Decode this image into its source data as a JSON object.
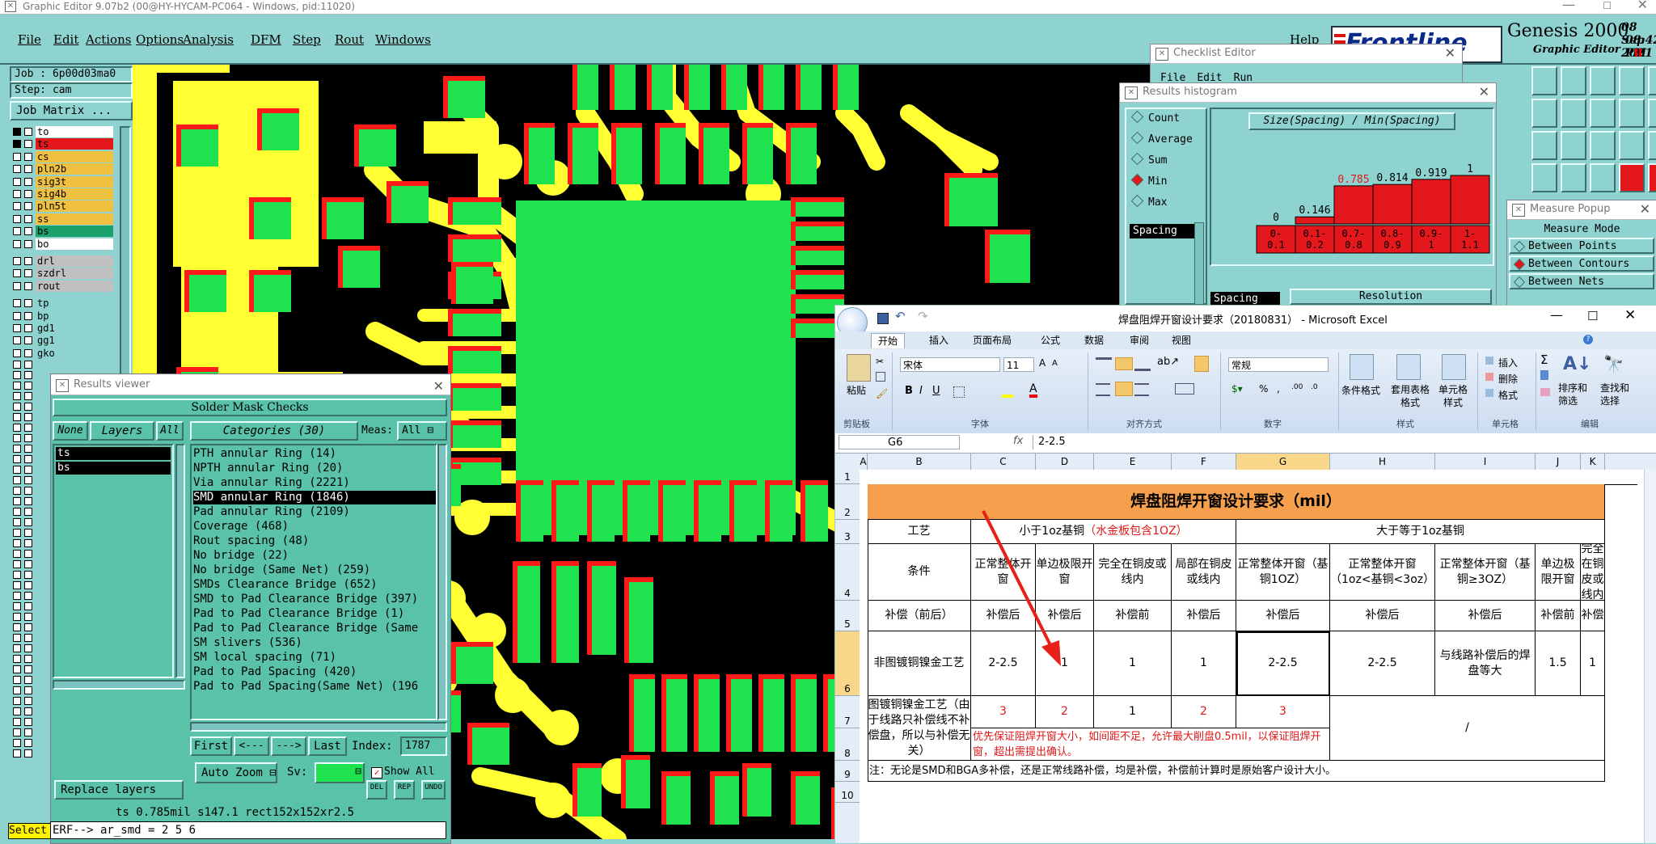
{
  "app": {
    "title": "Graphic Editor 9.07b2 (00@HY-HYCAM-PC064 - Windows, pid:11020)",
    "menu": [
      "File",
      "Edit",
      "Actions",
      "Options",
      "Analysis",
      "DFM",
      "Step",
      "Rout",
      "Windows"
    ],
    "help": "Help",
    "brand": "Frontline",
    "product": "Genesis 2000",
    "product_sub": "Graphic Editor",
    "date": "08 Sep 2021",
    "time": "08:42 PM"
  },
  "job": {
    "job_label": "Job : 6p00d03ma0",
    "step_label": "Step: cam",
    "matrix_button": "Job Matrix ..."
  },
  "layers": {
    "group1": [
      {
        "name": "to",
        "color": "#ffffff",
        "sel": true,
        "flag": true
      },
      {
        "name": "ts",
        "color": "#e4181c",
        "sel": true,
        "flag": true
      },
      {
        "name": "cs",
        "color": "#f0c040",
        "sel": false,
        "flag": true
      },
      {
        "name": "pln2b",
        "color": "#f0c040",
        "sel": false,
        "flag": false
      },
      {
        "name": "sig3t",
        "color": "#f0c040",
        "sel": false,
        "flag": false
      },
      {
        "name": "sig4b",
        "color": "#f0c040",
        "sel": false,
        "flag": false
      },
      {
        "name": "pln5t",
        "color": "#f0c040",
        "sel": false,
        "flag": true
      },
      {
        "name": "ss",
        "color": "#f0c040",
        "sel": false,
        "flag": true
      },
      {
        "name": "bs",
        "color": "#1aa06a",
        "sel": false,
        "flag": true
      },
      {
        "name": "bo",
        "color": "#ffffff",
        "sel": false,
        "flag": true
      }
    ],
    "group2": [
      {
        "name": "drl",
        "color": "#c0c0c0",
        "flag": false
      },
      {
        "name": "szdrl",
        "color": "#c0c0c0",
        "flag": false
      },
      {
        "name": "rout",
        "color": "#c0c0c0",
        "flag": false
      }
    ],
    "group3": [
      {
        "name": "tp",
        "flag": false
      },
      {
        "name": "bp",
        "flag": false
      },
      {
        "name": "gd1",
        "flag": true
      },
      {
        "name": "gg1",
        "flag": false
      },
      {
        "name": "gko",
        "flag": true
      }
    ]
  },
  "results_viewer": {
    "title": "Results viewer",
    "heading": "Solder Mask Checks",
    "none": "None",
    "layers": "Layers",
    "all": "All",
    "categories_label": "Categories (30)",
    "meas_label": "Meas:",
    "meas_value": "All",
    "layer_list": [
      "ts",
      "bs"
    ],
    "categories": [
      "PTH annular Ring (14)",
      "NPTH annular Ring (20)",
      "Via annular Ring (2221)",
      "SMD annular Ring (1846)",
      "Pad annular Ring (2109)",
      "Coverage (468)",
      "Rout spacing (48)",
      "No bridge (22)",
      "No bridge (Same Net) (259)",
      "SMDs Clearance Bridge (652)",
      "SMD to Pad Clearance Bridge (397)",
      "Pad to Pad Clearance Bridge (1)",
      "Pad to Pad Clearance Bridge (Same",
      "SM slivers (536)",
      "SM local spacing (71)",
      "Pad to Pad Spacing (420)",
      "Pad to Pad Spacing(Same Net) (196"
    ],
    "selected_index": 3,
    "nav": {
      "first": "First",
      "prev": "<---",
      "next": "--->",
      "last": "Last",
      "index_label": "Index:",
      "index_value": "1787"
    },
    "auto_zoom": "Auto Zoom",
    "sv_label": "Sv:",
    "show_all": "Show All",
    "replace_layers": "Replace layers",
    "icons": [
      "DEL",
      "REP",
      "UNDO"
    ],
    "status": "ts  0.785mil  s147.1  rect152x152xr2.5",
    "command": "ERF--> ar_smd = 2 5 6",
    "select_label": "Select"
  },
  "checklist": {
    "title": "Checklist Editor",
    "menu": [
      "File",
      "Edit",
      "Run"
    ]
  },
  "histogram": {
    "title": "Results histogram",
    "modes": [
      "Count",
      "Average",
      "Sum",
      "Min",
      "Max"
    ],
    "selected_mode": "Min",
    "spacing_label": "Spacing",
    "chart_title": "Size(Spacing) / Min(Spacing)",
    "resolution_label": "Resolution",
    "spacing_label2": "Spacing"
  },
  "chart_data": {
    "type": "bar",
    "title": "Size(Spacing) / Min(Spacing)",
    "categories": [
      "0-0.1",
      "0.1-0.2",
      "0.7-0.8",
      "0.8-0.9",
      "0.9-1",
      "1-1.1"
    ],
    "values": [
      0,
      0.146,
      0.785,
      0.814,
      0.919,
      1
    ],
    "labels": [
      "0",
      "0.146",
      "0.785",
      "0.814",
      "0.919",
      "1"
    ],
    "highlight_index": 2,
    "ylim": [
      0,
      1
    ]
  },
  "measure": {
    "title": "Measure Popup",
    "mode_label": "Measure Mode",
    "options": [
      "Between Points",
      "Between Contours",
      "Between Nets"
    ]
  },
  "excel": {
    "title": "焊盘阻焊开窗设计要求（20180831） - Microsoft Excel",
    "tabs": [
      "开始",
      "插入",
      "页面布局",
      "公式",
      "数据",
      "审阅",
      "视图"
    ],
    "clipboard": {
      "paste": "粘贴",
      "group": "剪贴板"
    },
    "font": {
      "name": "宋体",
      "size": "11",
      "group": "字体"
    },
    "align_group": "对齐方式",
    "number": {
      "format": "常规",
      "group": "数字"
    },
    "styles": {
      "conditional": "条件格式",
      "table": "套用表格格式",
      "cell": "单元格样式",
      "group": "样式"
    },
    "cells": {
      "insert": "插入",
      "delete": "删除",
      "format": "格式",
      "group": "单元格"
    },
    "editing": {
      "sum": "Σ",
      "sort": "排序和筛选",
      "find": "查找和选择",
      "group": "编辑"
    },
    "name_box": "G6",
    "fx": "fx",
    "formula": "2-2.5",
    "columns": [
      "A",
      "B",
      "C",
      "D",
      "E",
      "F",
      "G",
      "H",
      "I",
      "J",
      "K"
    ],
    "rows": [
      "1",
      "2",
      "3",
      "4",
      "5",
      "6",
      "7",
      "8",
      "9",
      "10"
    ],
    "sheet": {
      "main_title": "焊盘阻焊开窗设计要求（mil）",
      "process": "工艺",
      "lt1oz": "小于1oz基铜",
      "lt1oz_note": "（水金板包含1OZ）",
      "ge1oz": "大于等于1oz基铜",
      "condition": "条件",
      "headers": [
        "正常整体开窗",
        "单边极限开窗",
        "完全在铜皮或线内",
        "局部在铜皮或线内",
        "正常整体开窗（基铜1OZ）",
        "正常整体开窗（1oz<基铜<3oz）",
        "正常整体开窗（基铜≥3OZ）",
        "单边极限开窗",
        "完全在铜皮或线内"
      ],
      "comp_label": "补偿（前后）",
      "comp": [
        "补偿后",
        "补偿后",
        "补偿前",
        "补偿后",
        "补偿后",
        "补偿后",
        "补偿后",
        "补偿前",
        "补偿"
      ],
      "row6_label": "非图镀铜镍金工艺",
      "row6": [
        "2-2.5",
        "1",
        "1",
        "1",
        "2-2.5",
        "2-2.5",
        "与线路补偿后的焊盘等大",
        "1.5",
        "1"
      ],
      "row7_label": "图镀铜镍金工艺（由于线路只补偿线不补偿盘，所以与补偿无关）",
      "row7": [
        "3",
        "2",
        "1",
        "2",
        "3"
      ],
      "slash": "/",
      "row8_note": "优先保证阻焊开窗大小，如间距不足，允许最大削盘0.5mil，以保证阻焊开窗，超出需提出确认。",
      "footnote": "注：无论是SMD和BGA多补偿，还是正常线路补偿，均是补偿，补偿前计算时是原始客户设计大小。"
    }
  },
  "colors": {
    "panel": "#8fd3d0",
    "pcb_bg": "#000000",
    "pad": "#1fe24f",
    "trace": "#ffff33",
    "mask": "#ff1a1a",
    "excel_header": "#f6a04d",
    "excel_red": "#e01818",
    "arrow": "#e8201a"
  }
}
